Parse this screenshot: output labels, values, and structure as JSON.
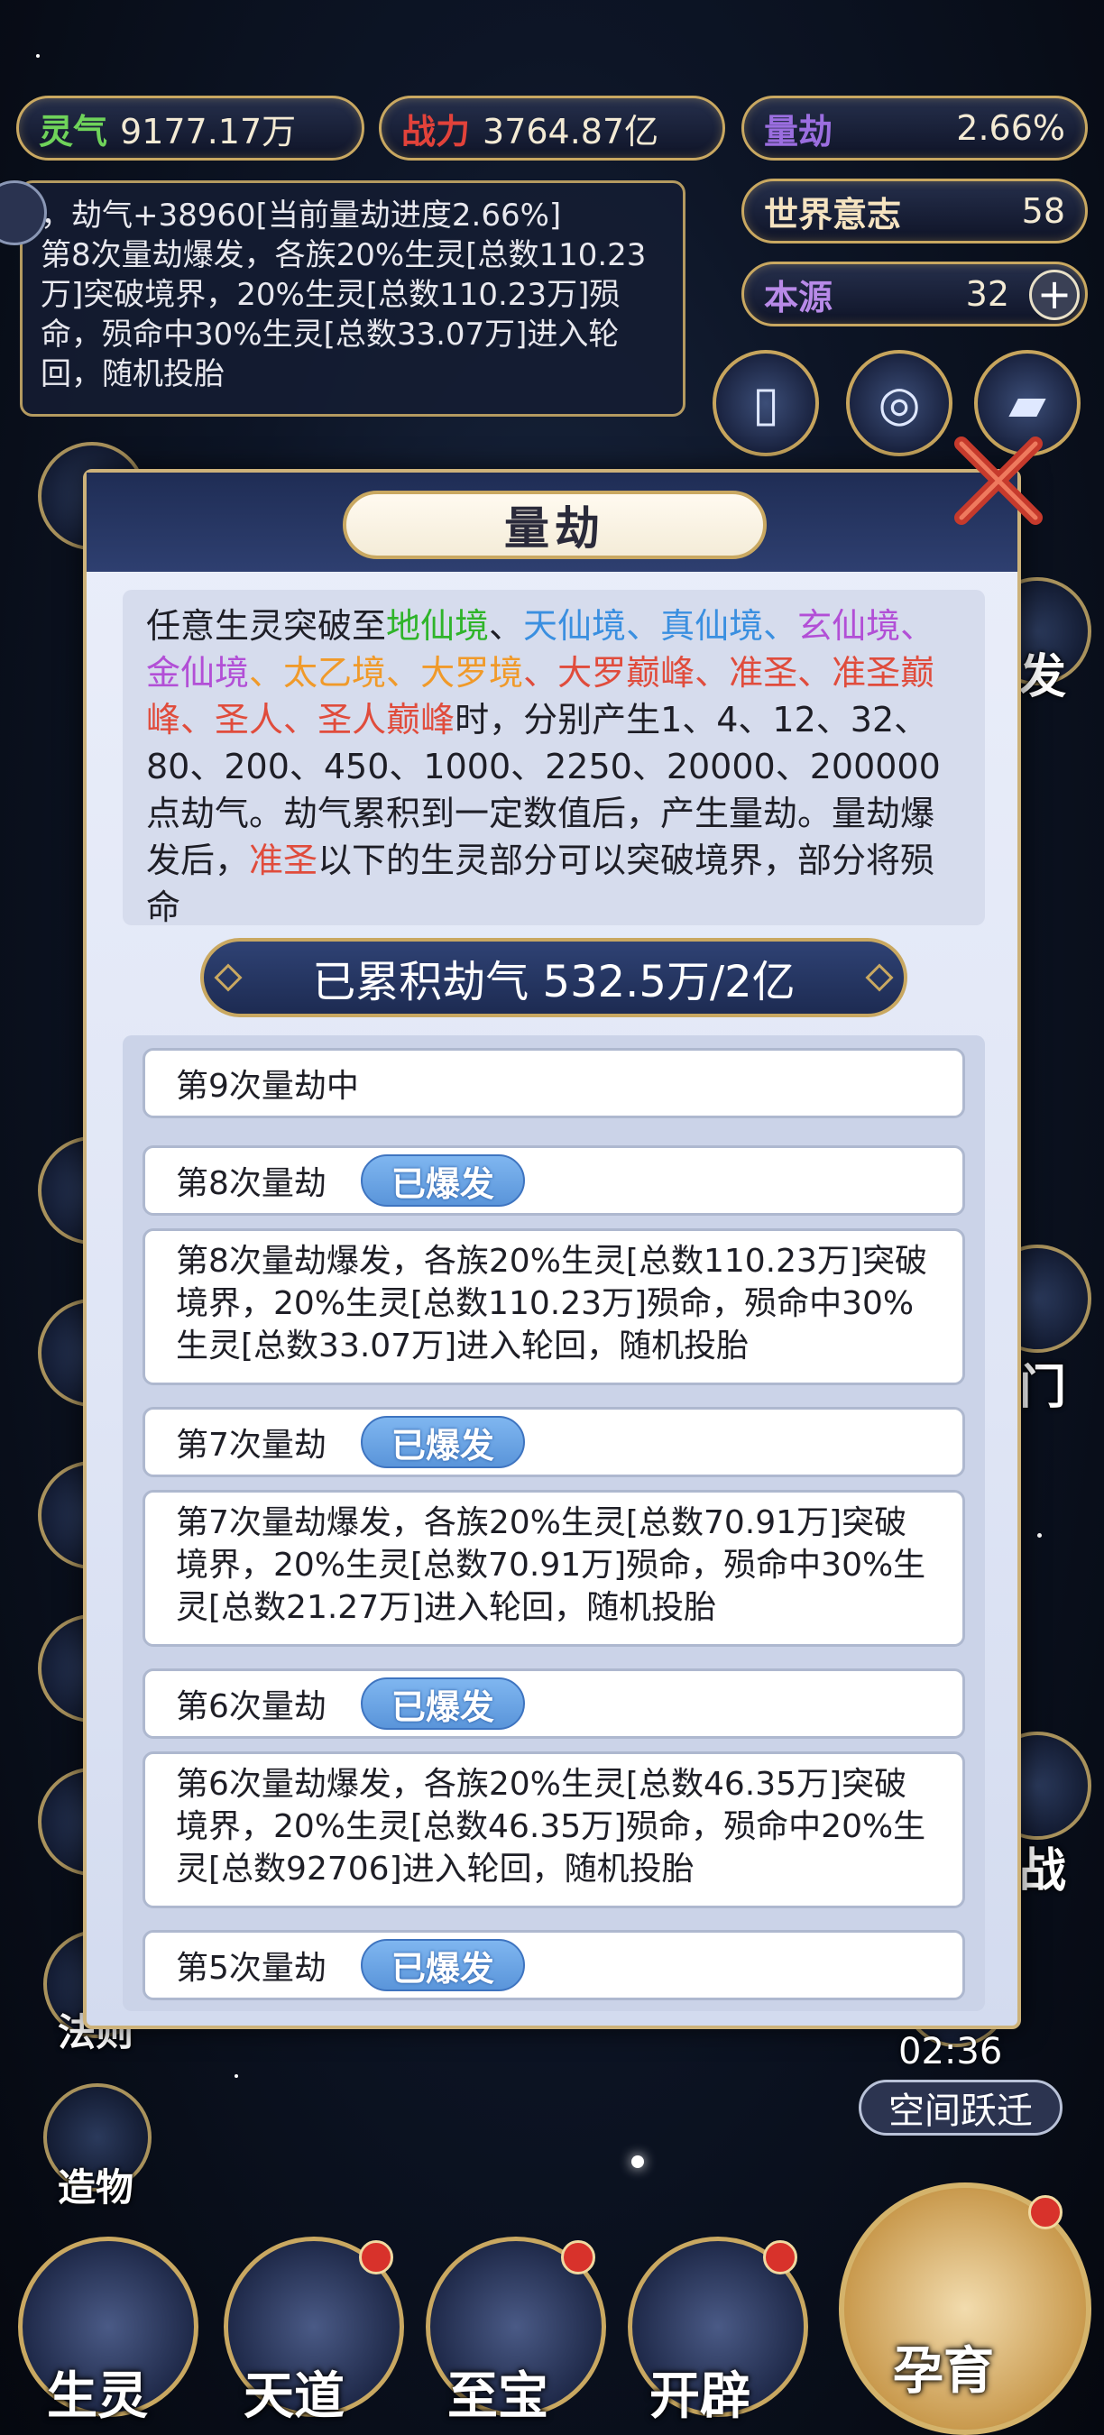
{
  "stats": {
    "lingqi_label": "灵气",
    "lingqi_value": "9177.17万",
    "zhanli_label": "战力",
    "zhanli_value": "3764.87亿",
    "liangjie_label": "量劫",
    "liangjie_value": "2.66%",
    "world_will_label": "世界意志",
    "world_will_value": "58",
    "origin_label": "本源",
    "origin_value": "32",
    "origin_add": "+"
  },
  "log": {
    "text": "，劫气+38960[当前量劫进度2.66%]\n第8次量劫爆发，各族20%生灵[总数110.23万]突破境界，20%生灵[总数110.23万]殒命，殒命中30%生灵[总数33.07万]进入轮回，随机投胎"
  },
  "side": {
    "right_partial_1": "发",
    "right_partial_2": "门",
    "right_partial_3": "战",
    "law": "法则",
    "creation": "造物",
    "timer": "02:36",
    "space_jump": "空间跃迁"
  },
  "bottom_nav": {
    "shengling": "生灵",
    "tiandao": "天道",
    "zhibao": "至宝",
    "kaipi": "开辟",
    "yunyu": "孕育"
  },
  "modal": {
    "title": "量劫",
    "desc": {
      "p1": "任意生灵突破至",
      "t1": "地仙境",
      "s1": "、",
      "t2": "天仙境",
      "s2": "、",
      "t3": "真仙境",
      "s3": "、",
      "t4": "玄仙境",
      "s4": "、",
      "t5": "金仙境",
      "s5": "、",
      "t6": "太乙境",
      "s6": "、",
      "t7": "大罗境",
      "s7": "、",
      "t8": "大罗巅峰",
      "s8": "、",
      "t9": "准圣",
      "s9": "、",
      "t10": "准圣巅峰",
      "s10": "、",
      "t11": "圣人",
      "s11": "、",
      "t12": "圣人巅峰",
      "p2": "时，分别产生1、4、12、32、80、200、450、1000、2250、20000、200000点劫气。劫气累积到一定数值后，产生量劫。量劫爆发后，",
      "t13": "准圣",
      "p3": "以下的生灵部分可以突破境界，部分将殒命"
    },
    "accumulated": "已累积劫气 532.5万/2亿",
    "rows": [
      {
        "title": "第9次量劫中"
      },
      {
        "title": "第8次量劫",
        "badge": "已爆发",
        "detail": "第8次量劫爆发，各族20%生灵[总数110.23万]突破境界，20%生灵[总数110.23万]殒命，殒命中30%生灵[总数33.07万]进入轮回，随机投胎"
      },
      {
        "title": "第7次量劫",
        "badge": "已爆发",
        "detail": "第7次量劫爆发，各族20%生灵[总数70.91万]突破境界，20%生灵[总数70.91万]殒命，殒命中30%生灵[总数21.27万]进入轮回，随机投胎"
      },
      {
        "title": "第6次量劫",
        "badge": "已爆发",
        "detail": "第6次量劫爆发，各族20%生灵[总数46.35万]突破境界，20%生灵[总数46.35万]殒命，殒命中20%生灵[总数92706]进入轮回，随机投胎"
      },
      {
        "title": "第5次量劫",
        "badge": "已爆发"
      }
    ]
  }
}
